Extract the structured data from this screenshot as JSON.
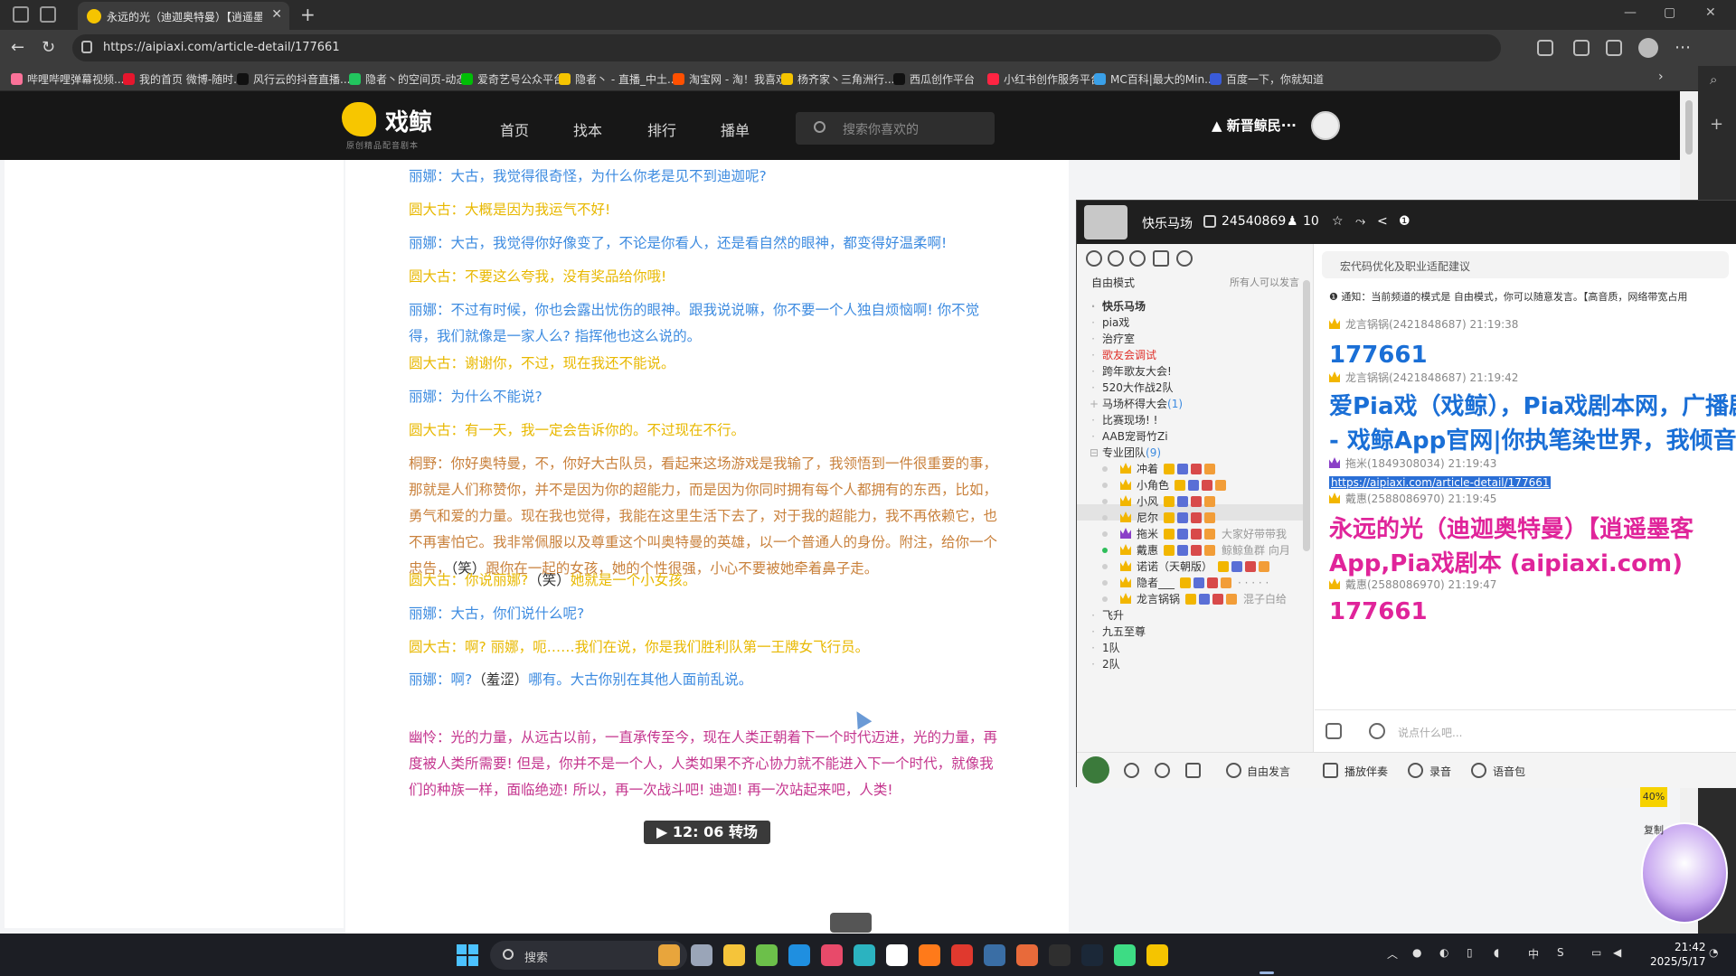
{
  "browser": {
    "tab_title": "永远的光（迪迦奥特曼）【逍遥墨",
    "url": "https://aipiaxi.com/article-detail/177661",
    "bookmarks": [
      {
        "label": "哔哩哔哩弹幕视频...",
        "color": "#fb7299"
      },
      {
        "label": "我的首页 微博-随时...",
        "color": "#e6162d"
      },
      {
        "label": "风行云的抖音直播...",
        "color": "#111111"
      },
      {
        "label": "隐者丶的空间页-动态",
        "color": "#22c55e"
      },
      {
        "label": "爱奇艺号公众平台",
        "color": "#00be06"
      },
      {
        "label": "隐者丶 - 直播_中土...",
        "color": "#f5c400"
      },
      {
        "label": "淘宝网 - 淘！我喜欢",
        "color": "#ff5000"
      },
      {
        "label": "杨齐家丶三角洲行...",
        "color": "#f5c400"
      },
      {
        "label": "西瓜创作平台",
        "color": "#111111"
      },
      {
        "label": "小红书创作服务平台",
        "color": "#ff2442"
      },
      {
        "label": "MC百科|最大的Min...",
        "color": "#3aa0e8"
      },
      {
        "label": "百度一下，你就知道",
        "color": "#3a5bd9"
      }
    ]
  },
  "site": {
    "logo": "戏鲸",
    "logo_sub": "原创精品配音剧本",
    "nav": [
      "首页",
      "找本",
      "排行",
      "播单"
    ],
    "search_placeholder": "搜索你喜欢的",
    "username": "新晋鲸民···"
  },
  "article": {
    "lines": [
      {
        "text": "丽娜：大古，我觉得很奇怪，为什么你老是见不到迪迦呢?",
        "color": "blue"
      },
      {
        "text": "圆大古：大概是因为我运气不好!",
        "color": "yellow"
      },
      {
        "text": "丽娜：大古，我觉得你好像变了，不论是你看人，还是看自然的眼神，都变得好温柔啊!",
        "color": "blue"
      },
      {
        "text": "圆大古：不要这么夸我，没有奖品给你哦!",
        "color": "yellow"
      },
      {
        "text": "丽娜：不过有时候，你也会露出忧伤的眼神。跟我说说嘛，你不要一个人独自烦恼啊! 你不觉得，我们就像是一家人么? 指挥他也这么说的。",
        "color": "blue"
      },
      {
        "text": "圆大古：谢谢你，不过，现在我还不能说。",
        "color": "yellow"
      },
      {
        "text": "丽娜：为什么不能说?",
        "color": "blue"
      },
      {
        "text": "圆大古：有一天，我一定会告诉你的。不过现在不行。",
        "color": "yellow"
      },
      {
        "text": "桐野：你好奥特曼，不，你好大古队员，看起来这场游戏是我输了，我领悟到一件很重要的事，那就是人们称赞你，并不是因为你的超能力，而是因为你同时拥有每个人都拥有的东西，比如，勇气和爱的力量。现在我也觉得，我能在这里生活下去了，对于我的超能力，我不再依赖它，也不再害怕它。我非常佩服以及尊重这个叫奥特曼的英雄，以一个普通人的身份。附注，给你一个忠告，",
        "mid": "（笑）",
        "tail": "跟你在一起的女孩，她的个性很强，小心不要被她牵着鼻子走。",
        "color": "brown"
      },
      {
        "text": "圆大古：你说丽娜?",
        "mid": "（笑）",
        "tail": "她就是一个小女孩。",
        "color": "yellow"
      },
      {
        "text": "丽娜：大古，你们说什么呢?",
        "color": "blue"
      },
      {
        "text": "圆大古：啊? 丽娜，呃……我们在说，你是我们胜利队第一王牌女飞行员。",
        "color": "yellow"
      },
      {
        "text": "丽娜：啊?",
        "mid": "（羞涩）",
        "tail": "哪有。大古你别在其他人面前乱说。",
        "color": "blue"
      },
      {
        "text": "幽怜：光的力量，从远古以前，一直承传至今，现在人类正朝着下一个时代迈进，光的力量，再度被人类所需要! 但是，你并不是一个人，人类如果不齐心协力就不能进入下一个时代，就像我们的种族一样，面临绝迹! 所以，再一次战斗吧! 迪迦! 再一次站起来吧，人类!",
        "color": "magenta"
      }
    ],
    "scene_button": "▶ 12: 06 转场"
  },
  "chat": {
    "room_name": "快乐马场",
    "room_id": "24540869",
    "online": "10",
    "mode": "自由模式",
    "mode_right": "所有人可以发言",
    "channels": [
      {
        "label": "快乐马场",
        "style": "bold"
      },
      {
        "label": "pia戏",
        "style": ""
      },
      {
        "label": "治疗室",
        "style": ""
      },
      {
        "label": "歌友会调试",
        "style": "red"
      },
      {
        "label": "跨年歌友大会!",
        "style": ""
      },
      {
        "label": "520大作战2队",
        "style": ""
      },
      {
        "label": "马场杯得大会",
        "count": "(1)",
        "style": ""
      },
      {
        "label": "比赛现场! !",
        "style": ""
      },
      {
        "label": "AAB宠哥竹Zi",
        "style": ""
      },
      {
        "label": "专业团队",
        "count": "(9)",
        "style": ""
      }
    ],
    "members": [
      {
        "name": "冲着",
        "online": false,
        "crown": "gold",
        "sig": ""
      },
      {
        "name": "小角色",
        "online": false,
        "crown": "gold",
        "sig": ""
      },
      {
        "name": "小风",
        "online": false,
        "crown": "gold",
        "sig": ""
      },
      {
        "name": "尼尔",
        "online": false,
        "crown": "gold",
        "sig": ""
      },
      {
        "name": "拖米",
        "online": false,
        "crown": "purple",
        "sig": "大家好带带我"
      },
      {
        "name": "戴惠",
        "online": true,
        "crown": "gold",
        "sig": "鲸鲸鱼群 向月"
      },
      {
        "name": "诺诺（天朝版）",
        "online": false,
        "crown": "gold",
        "sig": ""
      },
      {
        "name": "隐者___",
        "online": false,
        "crown": "gold",
        "sig": "· · · · ·"
      },
      {
        "name": "龙言锅锅",
        "online": false,
        "crown": "gold",
        "sig": "混子白给"
      }
    ],
    "more_channels": [
      "飞升",
      "九五至尊",
      "1队",
      "2队"
    ],
    "topic": "宏代码优化及职业适配建议",
    "notice": "通知：当前频道的模式是 自由模式，你可以随意发言。【高音质，网络带宽占用",
    "messages": [
      {
        "user": "龙言锅锅(2421848687)",
        "time": "21:19:38",
        "crown": "gold",
        "text": "177661",
        "color": "#1a6fd6"
      },
      {
        "user": "龙言锅锅(2421848687)",
        "time": "21:19:42",
        "crown": "gold",
        "text": "爱Pia戏（戏鲸），Pia戏剧本网，广播剧，",
        "text2": "- 戏鲸App官网|你执笔染世界，我倾音绘",
        "color": "#1a6fd6"
      },
      {
        "user": "拖米(1849308034)",
        "time": "21:19:43",
        "crown": "purple",
        "link": "https://aipiaxi.com/article-detail/177661"
      },
      {
        "user": "戴惠(2588086970)",
        "time": "21:19:45",
        "crown": "gold",
        "text": "永远的光（迪迦奥特曼）【逍遥墨客",
        "text2": "App,Pia戏剧本 (aipiaxi.com)",
        "color": "#e0249a"
      },
      {
        "user": "戴惠(2588086970)",
        "time": "21:19:47",
        "crown": "gold",
        "text": "177661",
        "color": "#e0249a"
      }
    ],
    "input_placeholder": "说点什么吧...",
    "bottom_buttons": [
      "自由发言",
      "播放伴奏",
      "录音",
      "语音包"
    ],
    "percent": "40%",
    "float_label": "复制"
  },
  "taskbar": {
    "search_label": "搜索",
    "time": "21:42",
    "date": "2025/5/17",
    "ime": "中"
  }
}
